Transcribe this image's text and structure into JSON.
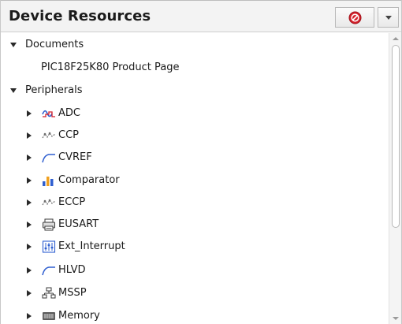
{
  "panel": {
    "title": "Device Resources"
  },
  "tree": {
    "documents": {
      "label": "Documents",
      "expanded": true,
      "children": [
        "PIC18F25K80 Product Page"
      ]
    },
    "peripherals": {
      "label": "Peripherals",
      "expanded": true,
      "children": [
        {
          "label": "ADC",
          "icon": "adc-icon"
        },
        {
          "label": "CCP",
          "icon": "ccp-icon"
        },
        {
          "label": "CVREF",
          "icon": "cvref-icon"
        },
        {
          "label": "Comparator",
          "icon": "comparator-icon"
        },
        {
          "label": "ECCP",
          "icon": "eccp-icon"
        },
        {
          "label": "EUSART",
          "icon": "eusart-icon"
        },
        {
          "label": "Ext_Interrupt",
          "icon": "ext-interrupt-icon"
        },
        {
          "label": "HLVD",
          "icon": "hlvd-icon"
        },
        {
          "label": "MSSP",
          "icon": "mssp-icon"
        },
        {
          "label": "Memory",
          "icon": "memory-icon"
        }
      ]
    }
  },
  "colors": {
    "accent_red": "#d4202a",
    "wave_blue": "#2f5fd0",
    "chart_orange": "#f0a020"
  }
}
